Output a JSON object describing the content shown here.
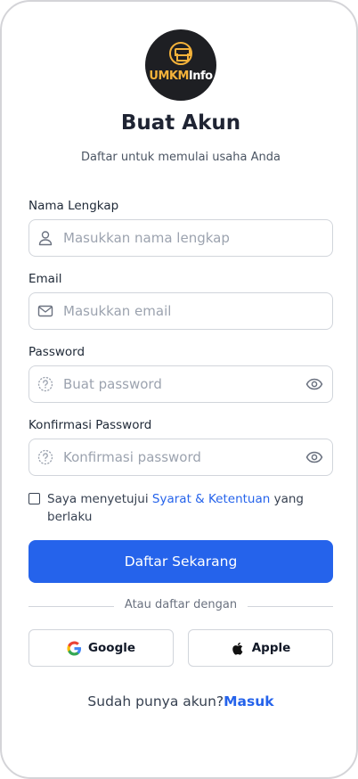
{
  "logo": {
    "brand_part1": "UMKM",
    "brand_part2": "Info"
  },
  "header": {
    "title": "Buat Akun",
    "subtitle": "Daftar untuk memulai usaha Anda"
  },
  "form": {
    "name": {
      "label": "Nama Lengkap",
      "placeholder": "Masukkan nama lengkap",
      "value": "",
      "icon": "user-icon"
    },
    "email": {
      "label": "Email",
      "placeholder": "Masukkan email",
      "value": "",
      "icon": "mail-icon"
    },
    "password": {
      "label": "Password",
      "placeholder": "Buat password",
      "value": "",
      "icon": "question-circle-icon",
      "toggle_icon": "eye-icon"
    },
    "confirm": {
      "label": "Konfirmasi Password",
      "placeholder": "Konfirmasi password",
      "value": "",
      "icon": "question-circle-icon",
      "toggle_icon": "eye-icon"
    },
    "terms": {
      "checked": false,
      "prefix": "Saya menyetujui",
      "link": "Syarat & Ketentuan",
      "suffix": "yang berlaku"
    },
    "submit_label": "Daftar Sekarang"
  },
  "social": {
    "divider_text": "Atau daftar dengan",
    "google_label": "Google",
    "apple_label": "Apple"
  },
  "footer": {
    "prompt": "Sudah punya akun?",
    "login_link": "Masuk"
  },
  "colors": {
    "primary": "#2563eb",
    "logo_bg": "#1e1f23",
    "logo_accent": "#f4b23a",
    "border": "#d1d5db"
  }
}
